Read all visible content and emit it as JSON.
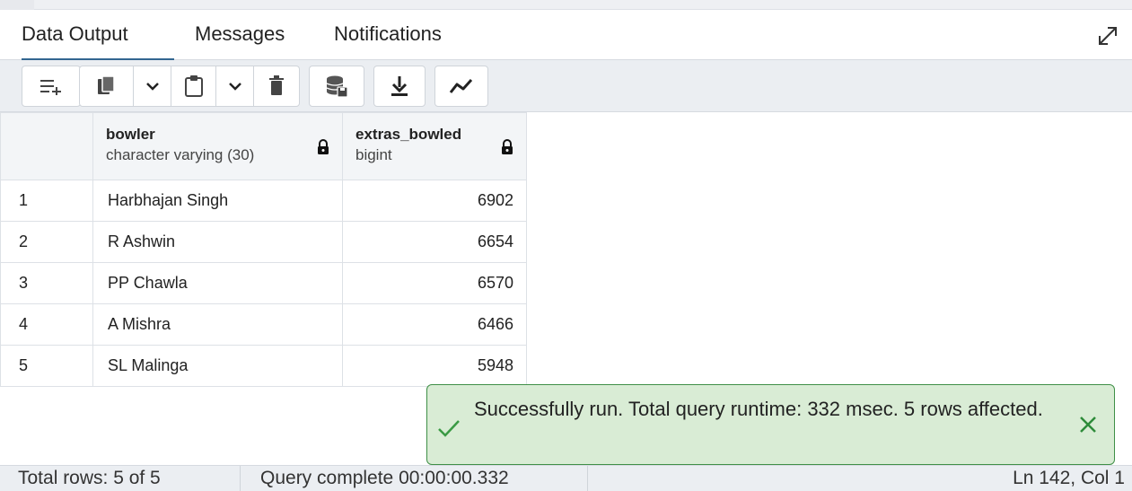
{
  "tabs": [
    {
      "label": "Data Output",
      "active": true
    },
    {
      "label": "Messages",
      "active": false
    },
    {
      "label": "Notifications",
      "active": false
    }
  ],
  "toolbar": {
    "buttons": [
      "add-row-icon",
      "copy-icon",
      "chevron-down-icon",
      "paste-icon",
      "chevron-down-icon",
      "delete-icon",
      "save-data-icon",
      "download-icon",
      "graph-icon"
    ]
  },
  "grid": {
    "columns": [
      {
        "name": "bowler",
        "type": "character varying (30)",
        "locked": true
      },
      {
        "name": "extras_bowled",
        "type": "bigint",
        "locked": true
      }
    ],
    "rows": [
      {
        "num": "1",
        "bowler": "Harbhajan Singh",
        "extras_bowled": "6902"
      },
      {
        "num": "2",
        "bowler": "R Ashwin",
        "extras_bowled": "6654"
      },
      {
        "num": "3",
        "bowler": "PP Chawla",
        "extras_bowled": "6570"
      },
      {
        "num": "4",
        "bowler": "A Mishra",
        "extras_bowled": "6466"
      },
      {
        "num": "5",
        "bowler": "SL Malinga",
        "extras_bowled": "5948"
      }
    ]
  },
  "toast": {
    "message": "Successfully run. Total query runtime: 332 msec. 5 rows affected."
  },
  "status": {
    "total_rows": "Total rows: 5 of 5",
    "query_complete": "Query complete 00:00:00.332",
    "cursor_position": "Ln 142, Col 1"
  },
  "colors": {
    "accent": "#326690",
    "toast_bg": "#d9ecd5",
    "toast_border": "#3f8f47"
  }
}
